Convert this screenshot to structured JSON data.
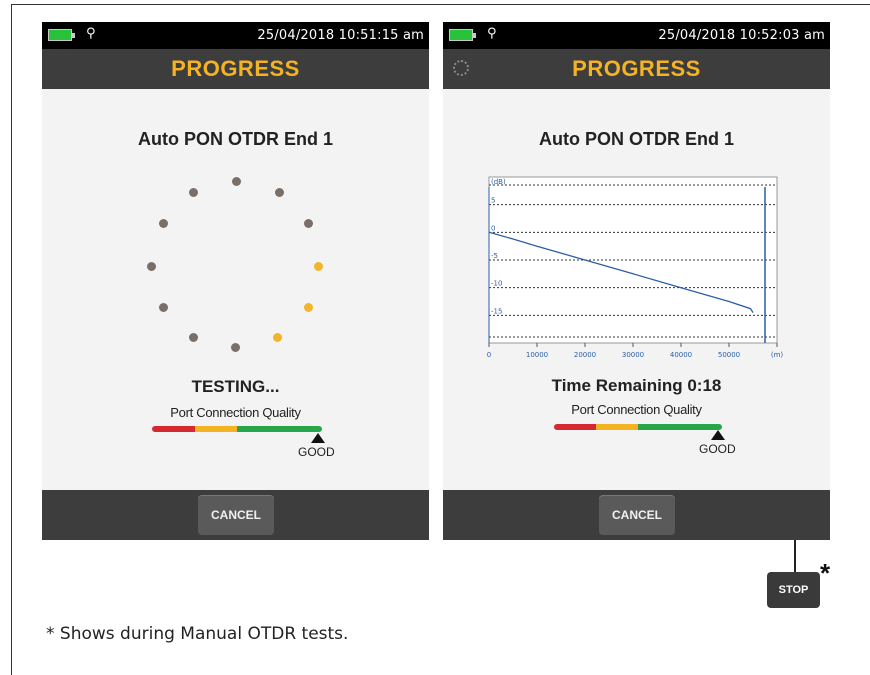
{
  "left_screen": {
    "status_bar": {
      "datetime": "25/04/2018 10:51:15 am",
      "battery_icon": "battery-icon",
      "link_icon": "link-icon"
    },
    "title": "PROGRESS",
    "test_name": "Auto PON OTDR End 1",
    "status": "TESTING...",
    "port_quality_label": "Port Connection Quality",
    "quality_value": "GOOD",
    "quality_level": 0.95,
    "cancel_label": "CANCEL"
  },
  "right_screen": {
    "status_bar": {
      "datetime": "25/04/2018 10:52:03 am",
      "battery_icon": "battery-icon",
      "link_icon": "link-icon"
    },
    "title": "PROGRESS",
    "test_name": "Auto PON OTDR End 1",
    "time_remaining": "Time Remaining 0:18",
    "port_quality_label": "Port Connection Quality",
    "quality_value": "GOOD",
    "quality_level": 0.95,
    "cancel_label": "CANCEL"
  },
  "stop_button_label": "STOP",
  "asterisk": "*",
  "footnote": "* Shows during Manual OTDR tests.",
  "colors": {
    "title": "#f4b322",
    "bar": "#3d3d3d",
    "meter_red": "#d7282f",
    "meter_yellow": "#f4b322",
    "meter_green": "#2aa64a",
    "trace": "#2b5ea8"
  },
  "chart_data": {
    "type": "line",
    "xlabel": "(m)",
    "ylabel": "(dB)",
    "x_ticks": [
      "0",
      "10000",
      "20000",
      "30000",
      "40000",
      "50000",
      "(m)"
    ],
    "y_ticks": [
      "(dB)",
      "5",
      "0",
      "-5",
      "-10",
      "-15"
    ],
    "xlim": [
      0,
      60000
    ],
    "ylim": [
      -20,
      10
    ],
    "series": [
      {
        "x": [
          0,
          5000,
          10000,
          20000,
          30000,
          40000,
          50000,
          54500,
          55000
        ],
        "y": [
          0,
          -1.2,
          -2.5,
          -5,
          -7.5,
          -10,
          -12.5,
          -13.8,
          -14.5
        ]
      }
    ],
    "grid": true
  }
}
